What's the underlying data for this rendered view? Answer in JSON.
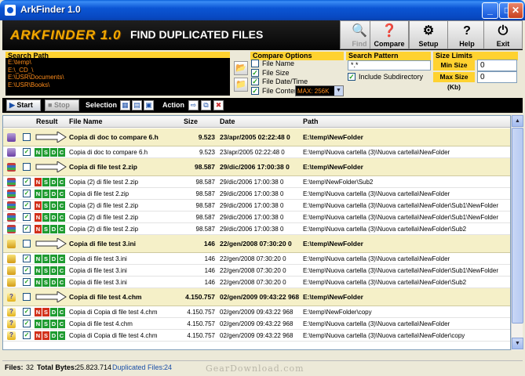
{
  "window": {
    "title": "ArkFinder 1.0",
    "minimize": "_",
    "maximize": "□",
    "close": "✕"
  },
  "header": {
    "logo": "ARKFINDER 1.0",
    "subtitle": "FIND DUPLICATED FILES"
  },
  "toolbar": [
    {
      "label": "Find",
      "icon": "find-icon",
      "enabled": false
    },
    {
      "label": "Compare",
      "icon": "compare-icon",
      "enabled": true
    },
    {
      "label": "Setup",
      "icon": "gear-icon",
      "enabled": true
    },
    {
      "label": "Help",
      "icon": "help-icon",
      "enabled": true
    },
    {
      "label": "Exit",
      "icon": "exit-icon",
      "enabled": true
    }
  ],
  "search_path": {
    "header": "Search Path",
    "paths": [
      "E:\\temp\\",
      "E:\\_CD_\\",
      "E:\\USR\\Documents\\",
      "E:\\USR\\Books\\"
    ]
  },
  "compare_options": {
    "header": "Compare Options",
    "options": [
      {
        "label": "File Name",
        "checked": false
      },
      {
        "label": "File Size",
        "checked": true
      },
      {
        "label": "File Date/Time",
        "checked": true
      },
      {
        "label": "File Content",
        "checked": true
      }
    ],
    "max_select": "MAX: 256K"
  },
  "search_pattern": {
    "header": "Search Pattern",
    "value": "*.*",
    "include_subdirectory_label": "Include Subdirectory",
    "include_subdirectory": true
  },
  "size_limits": {
    "header": "Size Limits",
    "min_label": "Min Size (Kb)",
    "min_value": "0",
    "max_label": "Max Size (Kb)",
    "max_value": "0"
  },
  "actionbar": {
    "start": "Start",
    "stop": "Stop",
    "selection": "Selection",
    "action": "Action"
  },
  "table": {
    "columns": [
      "Result",
      "File Name",
      "Size",
      "Date",
      "Path"
    ],
    "groups": [
      {
        "icon": "h",
        "name": "Copia di doc to compare 6.h",
        "size": "9.523",
        "date": "23/apr/2005 02:22:48 0",
        "path": "E:\\temp\\NewFolder",
        "files": [
          {
            "name": "Copia di doc to compare 6.h",
            "size": "9.523",
            "date": "23/apr/2005 02:22:48 0",
            "path": "E:\\temp\\Nuova cartella (3)\\Nuova cartella\\NewFolder",
            "flags": [
              "g",
              "g",
              "g",
              "g"
            ]
          }
        ]
      },
      {
        "icon": "zip",
        "name": "Copia di file test 2.zip",
        "size": "98.587",
        "date": "29/dic/2006 17:00:38 0",
        "path": "E:\\temp\\NewFolder",
        "files": [
          {
            "name": "Copia (2) di file test 2.zip",
            "size": "98.587",
            "date": "29/dic/2006 17:00:38 0",
            "path": "E:\\temp\\NewFolder\\Sub2",
            "flags": [
              "r",
              "g",
              "g",
              "g"
            ]
          },
          {
            "name": "Copia di file test 2.zip",
            "size": "98.587",
            "date": "29/dic/2006 17:00:38 0",
            "path": "E:\\temp\\Nuova cartella (3)\\Nuova cartella\\NewFolder",
            "flags": [
              "g",
              "g",
              "g",
              "g"
            ]
          },
          {
            "name": "Copia (2) di file test 2.zip",
            "size": "98.587",
            "date": "29/dic/2006 17:00:38 0",
            "path": "E:\\temp\\Nuova cartella (3)\\Nuova cartella\\NewFolder\\Sub1\\NewFolder",
            "flags": [
              "r",
              "g",
              "g",
              "g"
            ]
          },
          {
            "name": "Copia (2) di file test 2.zip",
            "size": "98.587",
            "date": "29/dic/2006 17:00:38 0",
            "path": "E:\\temp\\Nuova cartella (3)\\Nuova cartella\\NewFolder\\Sub1\\NewFolder",
            "flags": [
              "r",
              "g",
              "g",
              "g"
            ]
          },
          {
            "name": "Copia (2) di file test 2.zip",
            "size": "98.587",
            "date": "29/dic/2006 17:00:38 0",
            "path": "E:\\temp\\Nuova cartella (3)\\Nuova cartella\\NewFolder\\Sub2",
            "flags": [
              "r",
              "g",
              "g",
              "g"
            ]
          }
        ]
      },
      {
        "icon": "ini",
        "name": "Copia di file test 3.ini",
        "size": "146",
        "date": "22/gen/2008 07:30:20 0",
        "path": "E:\\temp\\NewFolder",
        "files": [
          {
            "name": "Copia di file test 3.ini",
            "size": "146",
            "date": "22/gen/2008 07:30:20 0",
            "path": "E:\\temp\\Nuova cartella (3)\\Nuova cartella\\NewFolder",
            "flags": [
              "g",
              "g",
              "g",
              "g"
            ]
          },
          {
            "name": "Copia di file test 3.ini",
            "size": "146",
            "date": "22/gen/2008 07:30:20 0",
            "path": "E:\\temp\\Nuova cartella (3)\\Nuova cartella\\NewFolder\\Sub1\\NewFolder",
            "flags": [
              "g",
              "g",
              "g",
              "g"
            ]
          },
          {
            "name": "Copia di file test 3.ini",
            "size": "146",
            "date": "22/gen/2008 07:30:20 0",
            "path": "E:\\temp\\Nuova cartella (3)\\Nuova cartella\\NewFolder\\Sub2",
            "flags": [
              "g",
              "g",
              "g",
              "g"
            ]
          }
        ]
      },
      {
        "icon": "chm",
        "name": "Copia di file test 4.chm",
        "size": "4.150.757",
        "date": "02/gen/2009 09:43:22 968",
        "path": "E:\\temp\\NewFolder",
        "files": [
          {
            "name": "Copia di Copia di file test 4.chm",
            "size": "4.150.757",
            "date": "02/gen/2009 09:43:22 968",
            "path": "E:\\temp\\NewFolder\\copy",
            "flags": [
              "r",
              "r",
              "g",
              "g"
            ]
          },
          {
            "name": "Copia di file test 4.chm",
            "size": "4.150.757",
            "date": "02/gen/2009 09:43:22 968",
            "path": "E:\\temp\\Nuova cartella (3)\\Nuova cartella\\NewFolder",
            "flags": [
              "g",
              "g",
              "g",
              "g"
            ]
          },
          {
            "name": "Copia di Copia di file test 4.chm",
            "size": "4.150.757",
            "date": "02/gen/2009 09:43:22 968",
            "path": "E:\\temp\\Nuova cartella (3)\\Nuova cartella\\NewFolder\\copy",
            "flags": [
              "r",
              "r",
              "g",
              "g"
            ]
          }
        ]
      }
    ],
    "nsdc_letters": [
      "N",
      "S",
      "D",
      "C"
    ]
  },
  "status": {
    "files_label": "Files:",
    "files": "32",
    "bytes_label": "Total Bytes:",
    "bytes": "25.823.714",
    "dups_label": "Duplicated Files:",
    "dups": "24"
  },
  "watermark": "GearDownload.com",
  "colors": {
    "accent": "#ffd230",
    "match_green": "#1e9b30",
    "mismatch_red": "#d2301a",
    "group_row": "#f5f0c8"
  }
}
